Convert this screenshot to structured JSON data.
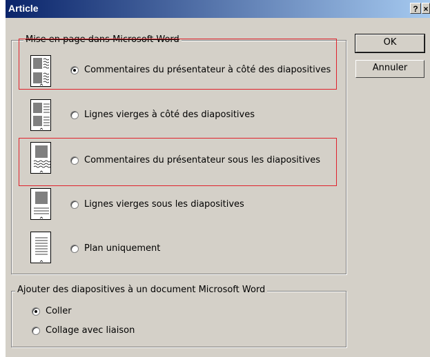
{
  "window": {
    "title": "Article",
    "help_button": "?",
    "close_button": "×"
  },
  "layout_group": {
    "legend": "Mise en page dans Microsoft Word",
    "options": [
      {
        "label": "Commentaires du présentateur à côté des diapositives",
        "checked": true,
        "icon": "notes-beside-slides-icon"
      },
      {
        "label": "Lignes vierges à côté des diapositives",
        "checked": false,
        "icon": "blank-lines-beside-slides-icon"
      },
      {
        "label": "Commentaires du présentateur sous les diapositives",
        "checked": false,
        "icon": "notes-below-slides-icon"
      },
      {
        "label": "Lignes vierges sous les diapositives",
        "checked": false,
        "icon": "blank-lines-below-slides-icon"
      },
      {
        "label": "Plan uniquement",
        "checked": false,
        "icon": "outline-only-icon"
      }
    ]
  },
  "paste_group": {
    "legend": "Ajouter des diapositives à un document Microsoft Word",
    "options": [
      {
        "label": "Coller",
        "checked": true
      },
      {
        "label": "Collage avec liaison",
        "checked": false
      }
    ]
  },
  "buttons": {
    "ok": "OK",
    "cancel": "Annuler"
  },
  "annotation_color": "#e0202a"
}
